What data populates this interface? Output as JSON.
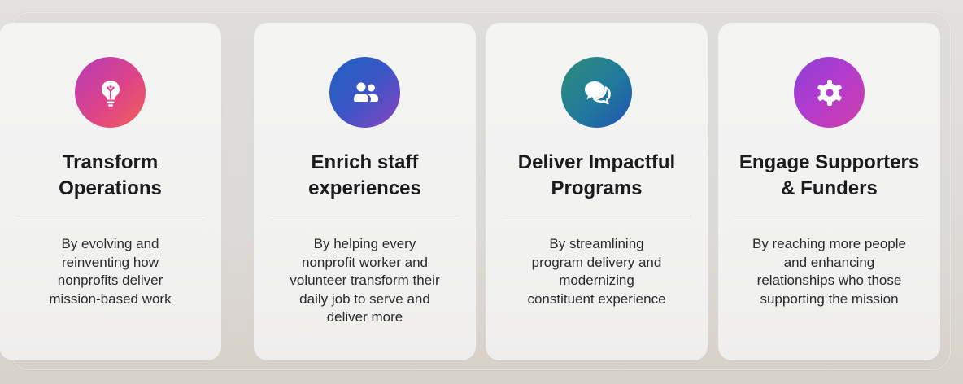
{
  "cards": [
    {
      "icon": "people-icon",
      "accent": "#3c55c6",
      "title_line1": "Enrich staff",
      "title_line2": "experiences",
      "description": "By helping every\nnonprofit worker and\nvolunteer transform their\ndaily job to serve and\ndeliver more"
    },
    {
      "icon": "chat-bubbles-icon",
      "accent": "#207a9d",
      "title_line1": "Deliver Impactful",
      "title_line2": "Programs",
      "description": "By streamlining\nprogram delivery and\nmodernizing\nconstituent experience"
    },
    {
      "icon": "gear-icon",
      "accent": "#b13bcf",
      "title_line1": "Engage Supporters",
      "title_line2": "& Funders",
      "description": "By reaching more people\nand enhancing\nrelationships who those\nsupporting the mission"
    },
    {
      "icon": "lightbulb-icon",
      "accent": "#dd4488",
      "title_line1": "Transform",
      "title_line2": "Operations",
      "description": "By evolving and\nreinventing how\nnonprofits deliver\nmission-based work"
    }
  ]
}
